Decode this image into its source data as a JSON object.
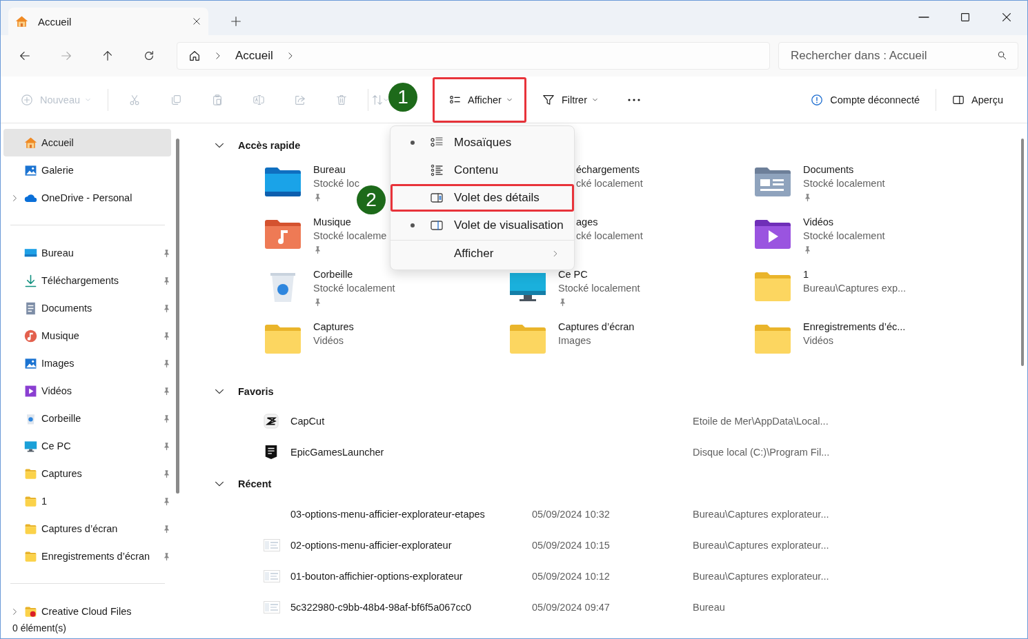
{
  "tab": {
    "title": "Accueil"
  },
  "address": {
    "forward_disabled": true,
    "crumbs": [
      "Accueil"
    ]
  },
  "search": {
    "placeholder": "Rechercher dans : Accueil"
  },
  "toolbar": {
    "items": [
      {
        "kind": "new",
        "label": "Nouveau",
        "disabled": true,
        "highlighted": false
      },
      {
        "kind": "cut",
        "disabled": true,
        "highlighted": false
      },
      {
        "kind": "copy",
        "disabled": true,
        "highlighted": false
      },
      {
        "kind": "paste",
        "disabled": true,
        "highlighted": false
      },
      {
        "kind": "rename",
        "disabled": true,
        "highlighted": false
      },
      {
        "kind": "share",
        "disabled": true,
        "highlighted": false
      },
      {
        "kind": "delete",
        "disabled": true,
        "highlighted": false
      },
      {
        "kind": "sort",
        "disabled": true,
        "highlighted": false
      },
      {
        "kind": "view",
        "label": "Afficher",
        "disabled": false,
        "highlighted": true
      },
      {
        "kind": "filter",
        "label": "Filtrer",
        "disabled": false,
        "highlighted": false
      },
      {
        "kind": "more",
        "disabled": false,
        "highlighted": false
      }
    ],
    "right": [
      {
        "kind": "account",
        "label": "Compte déconnecté"
      },
      {
        "kind": "pane",
        "label": "Aperçu"
      }
    ]
  },
  "sidebar": {
    "groups": [
      {
        "items": [
          {
            "label": "Accueil",
            "kind": "home",
            "selected": true,
            "expandable": false,
            "pinned": false
          },
          {
            "label": "Galerie",
            "kind": "gallery",
            "selected": false,
            "expandable": false,
            "pinned": false
          },
          {
            "label": "OneDrive - Personal",
            "kind": "cloud",
            "selected": false,
            "expandable": true,
            "pinned": false
          }
        ]
      },
      {
        "items": [
          {
            "label": "Bureau",
            "kind": "desktop",
            "selected": false,
            "expandable": false,
            "pinned": true
          },
          {
            "label": "Téléchargements",
            "kind": "download",
            "selected": false,
            "expandable": false,
            "pinned": true
          },
          {
            "label": "Documents",
            "kind": "documents",
            "selected": false,
            "expandable": false,
            "pinned": true
          },
          {
            "label": "Musique",
            "kind": "music",
            "selected": false,
            "expandable": false,
            "pinned": true
          },
          {
            "label": "Images",
            "kind": "images",
            "selected": false,
            "expandable": false,
            "pinned": true
          },
          {
            "label": "Vidéos",
            "kind": "videos",
            "selected": false,
            "expandable": false,
            "pinned": true
          },
          {
            "label": "Corbeille",
            "kind": "recycle",
            "selected": false,
            "expandable": false,
            "pinned": true
          },
          {
            "label": "Ce PC",
            "kind": "pc",
            "selected": false,
            "expandable": false,
            "pinned": true
          },
          {
            "label": "Captures",
            "kind": "folder",
            "selected": false,
            "expandable": false,
            "pinned": true
          },
          {
            "label": "1",
            "kind": "folder",
            "selected": false,
            "expandable": false,
            "pinned": true
          },
          {
            "label": "Captures d’écran",
            "kind": "folder",
            "selected": false,
            "expandable": false,
            "pinned": true
          },
          {
            "label": "Enregistrements d’écran",
            "kind": "folder",
            "selected": false,
            "expandable": false,
            "pinned": true
          }
        ]
      },
      {
        "items": [
          {
            "label": "Creative Cloud Files",
            "kind": "creative",
            "selected": false,
            "expandable": true,
            "pinned": false
          }
        ]
      }
    ]
  },
  "quick_access": {
    "title": "Accès rapide",
    "expanded": true,
    "tiles": [
      {
        "title": "Bureau",
        "subtitle": "Stocké loc",
        "kind": "desktop",
        "pinned": true
      },
      {
        "title": "échargements",
        "subtitle": "cké localement",
        "kind": "covered",
        "pinned": false
      },
      {
        "title": "Documents",
        "subtitle": "Stocké localement",
        "kind": "documents",
        "pinned": true
      },
      {
        "title": "Musique",
        "subtitle": "Stocké localeme",
        "kind": "music",
        "pinned": true
      },
      {
        "title": "ages",
        "subtitle": "cké localement",
        "kind": "covered",
        "pinned": false
      },
      {
        "title": "Vidéos",
        "subtitle": "Stocké localement",
        "kind": "videos",
        "pinned": true
      },
      {
        "title": "Corbeille",
        "subtitle": "Stocké localement",
        "kind": "recycle",
        "pinned": true
      },
      {
        "title": "Ce PC",
        "subtitle": "Stocké localement",
        "kind": "pc",
        "pinned": true
      },
      {
        "title": "1",
        "subtitle": "Bureau\\Captures exp...",
        "kind": "folder",
        "pinned": false
      },
      {
        "title": "Captures",
        "subtitle": "Vidéos",
        "kind": "folder",
        "pinned": false
      },
      {
        "title": "Captures d’écran",
        "subtitle": "Images",
        "kind": "folder",
        "pinned": false
      },
      {
        "title": "Enregistrements d’éc...",
        "subtitle": "Vidéos",
        "kind": "folder",
        "pinned": false
      }
    ]
  },
  "favorites": {
    "title": "Favoris",
    "expanded": true,
    "rows": [
      {
        "name": "CapCut",
        "location": "Etoile de Mer\\AppData\\Local...",
        "kind": "capcut"
      },
      {
        "name": "EpicGamesLauncher",
        "location": "Disque local (C:)\\Program Fil...",
        "kind": "epic"
      }
    ]
  },
  "recent": {
    "title": "Récent",
    "expanded": true,
    "rows": [
      {
        "name": "03-options-menu-afficier-explorateur-etapes",
        "date": "05/09/2024 10:32",
        "location": "Bureau\\Captures explorateur...",
        "kind": "blank"
      },
      {
        "name": "02-options-menu-afficier-explorateur",
        "date": "05/09/2024 10:15",
        "location": "Bureau\\Captures explorateur...",
        "kind": "thumb"
      },
      {
        "name": "01-bouton-affichier-options-explorateur",
        "date": "05/09/2024 10:12",
        "location": "Bureau\\Captures explorateur...",
        "kind": "thumb"
      },
      {
        "name": "5c322980-c9bb-48b4-98af-bf6f5a067cc0",
        "date": "05/09/2024 09:47",
        "location": "Bureau",
        "kind": "thumb"
      }
    ]
  },
  "view_menu": {
    "items": [
      {
        "label": "Mosaïques",
        "kind": "tiles",
        "bullet": true,
        "highlighted": false
      },
      {
        "label": "Contenu",
        "kind": "content",
        "bullet": false,
        "highlighted": false
      },
      {
        "label": "Volet des détails",
        "kind": "details",
        "bullet": false,
        "highlighted": true
      },
      {
        "label": "Volet de visualisation",
        "kind": "preview",
        "bullet": true,
        "highlighted": false
      },
      {
        "label": "Afficher",
        "kind": "submenu",
        "bullet": false,
        "highlighted": false
      }
    ]
  },
  "callouts": [
    "1",
    "2"
  ],
  "status_bar": {
    "text": "0 élément(s)"
  }
}
